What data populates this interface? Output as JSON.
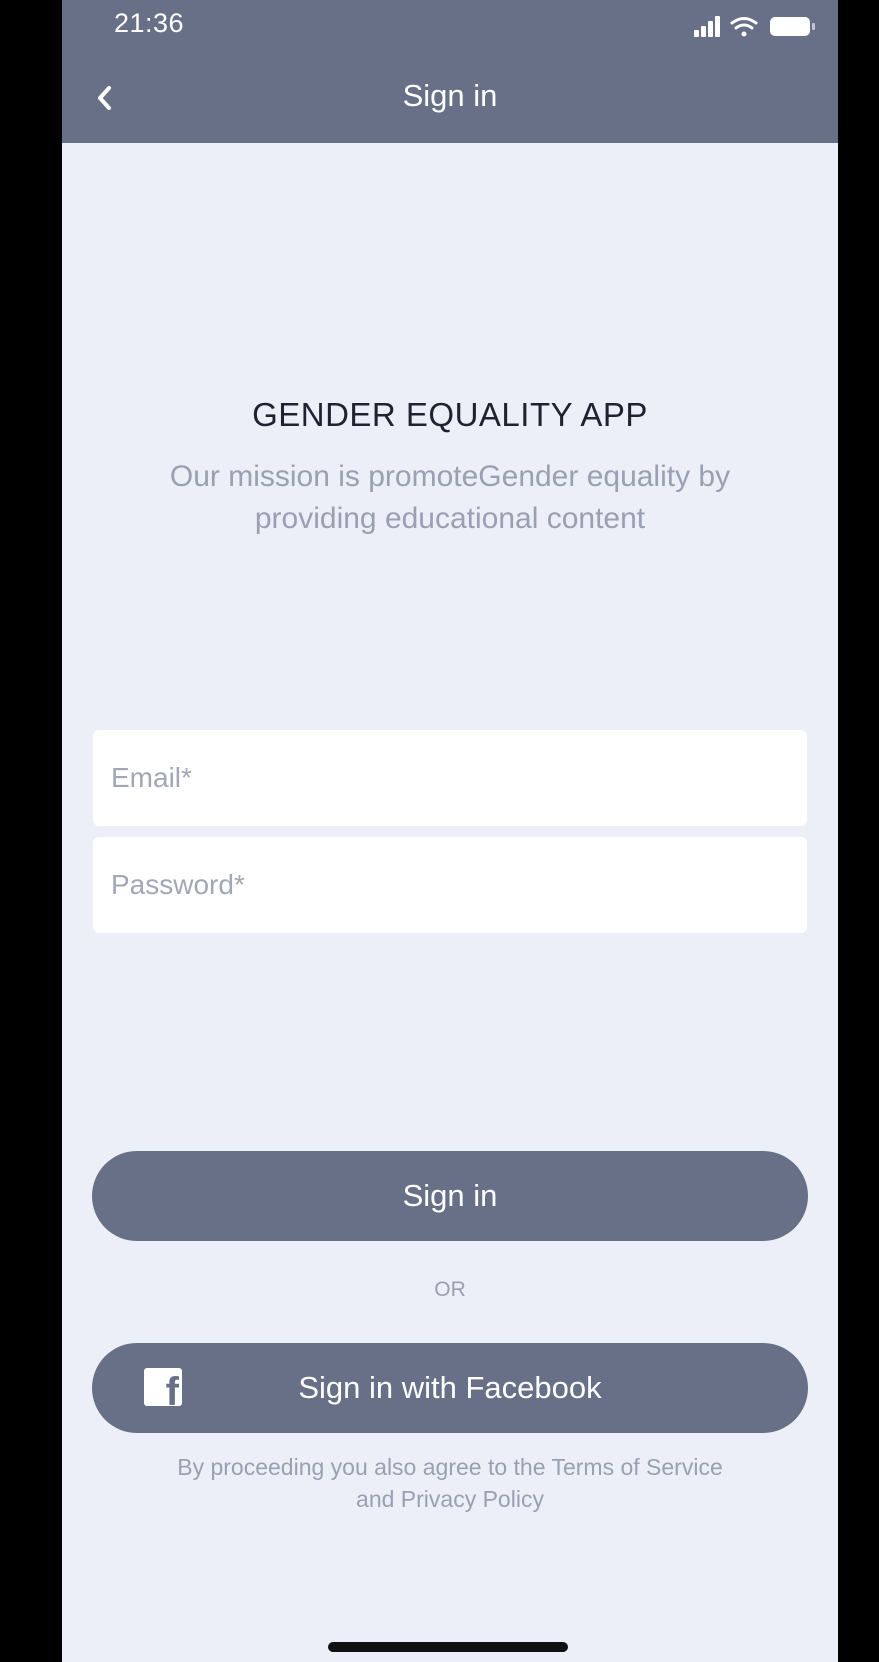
{
  "status_bar": {
    "time": "21:36",
    "icons": [
      "signal-icon",
      "wifi-icon",
      "battery-icon"
    ]
  },
  "header": {
    "back_icon": "chevron-left-icon",
    "title": "Sign in"
  },
  "intro": {
    "app_title": "GENDER EQUALITY APP",
    "mission_line1": "Our mission is promoteGender equality by",
    "mission_line2": "providing educational content"
  },
  "form": {
    "email": {
      "value": "",
      "placeholder": "Email*"
    },
    "password": {
      "value": "",
      "placeholder": "Password*"
    }
  },
  "actions": {
    "sign_in_label": "Sign in",
    "or_label": "OR",
    "facebook_label": "Sign in with Facebook",
    "facebook_icon": "facebook-icon"
  },
  "terms": {
    "line1": "By proceeding you also agree to the Terms of Service",
    "line2": "and Privacy Policy"
  },
  "colors": {
    "header_bg": "#687087",
    "page_bg": "#eceff8",
    "button_bg": "#687087",
    "muted_text": "#9aa0b1"
  }
}
